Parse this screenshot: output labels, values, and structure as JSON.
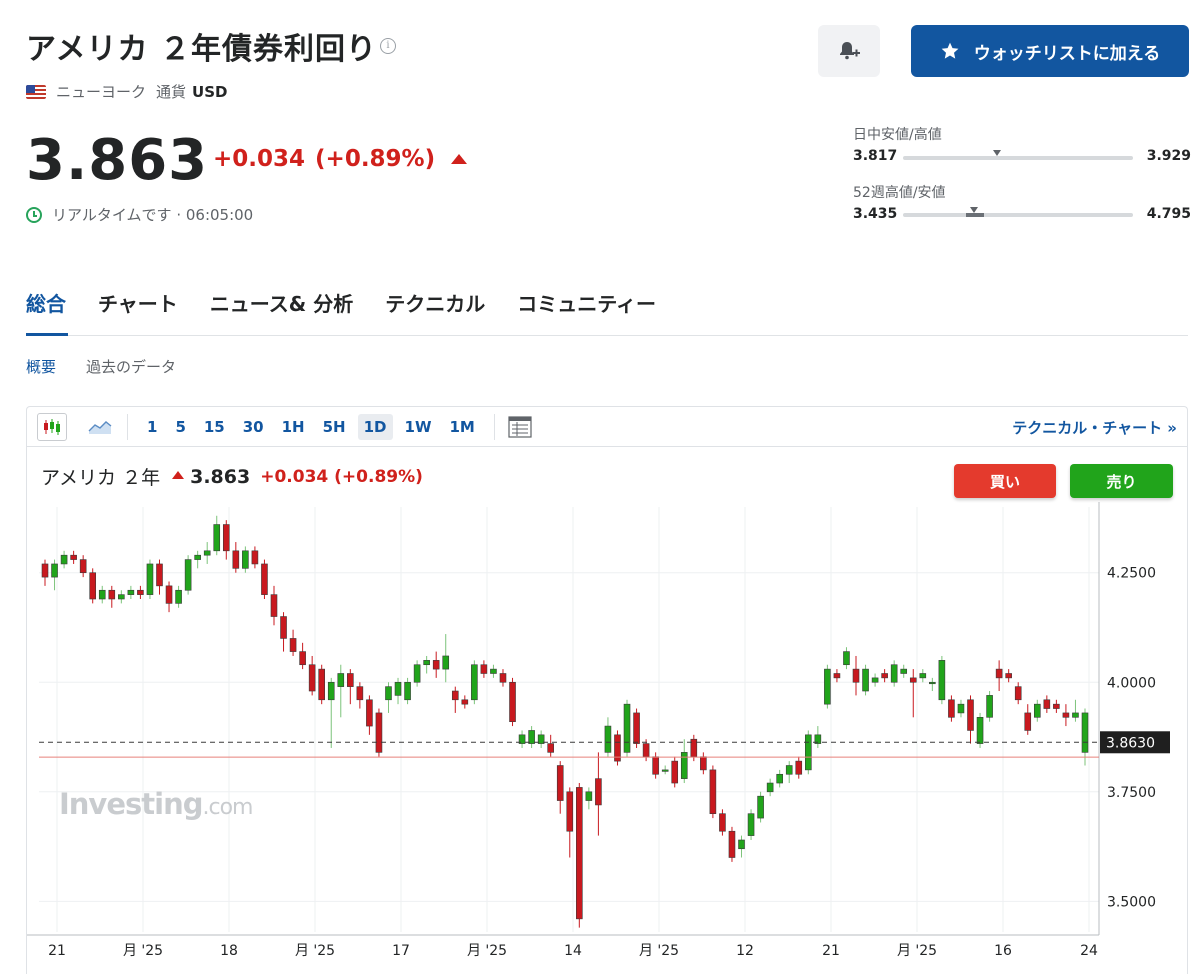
{
  "header": {
    "title": "アメリカ ２年債券利回り",
    "location": "ニューヨーク",
    "currency_label": "通貨",
    "currency": "USD",
    "watchlist_label": "ウォッチリストに加える",
    "info_glyph": "i"
  },
  "quote": {
    "price": "3.863",
    "change": "+0.034",
    "change_pct": "(+0.89%)",
    "realtime": "リアルタイムです · 06:05:00"
  },
  "ranges": {
    "day_label": "日中安値/高値",
    "day_low": "3.817",
    "day_high": "3.929",
    "day_position": 0.41,
    "week52_label": "52週高値/安値",
    "week52_low": "3.435",
    "week52_high": "4.795",
    "week52_position": 0.31
  },
  "tabs": [
    "総合",
    "チャート",
    "ニュース& 分析",
    "テクニカル",
    "コミュニティー"
  ],
  "subtabs": [
    "概要",
    "過去のデータ"
  ],
  "toolbar": {
    "intervals": [
      "1",
      "5",
      "15",
      "30",
      "1H",
      "5H",
      "1D",
      "1W",
      "1M"
    ],
    "active_interval": "1D",
    "tech_chart_label": "テクニカル・チャート »"
  },
  "legend": {
    "name": "アメリカ ２年",
    "price": "3.863",
    "change": "+0.034 (+0.89%)"
  },
  "buttons": {
    "buy": "買い",
    "sell": "売り"
  },
  "watermark": {
    "main": "Investing",
    "suffix": ".com"
  },
  "colors": {
    "up": "#21a41b",
    "down": "#c8191f",
    "accent": "#1256a0",
    "change": "#d0211c"
  },
  "chart_data": {
    "type": "candlestick",
    "y_ticks": [
      3.5,
      3.75,
      4.0,
      4.25
    ],
    "y_tick_labels": [
      "3.5000",
      "3.7500",
      "4.0000",
      "4.2500"
    ],
    "ylim": [
      3.43,
      4.4
    ],
    "x_tick_labels": [
      "21",
      "月 '25",
      "18",
      "月 '25",
      "17",
      "月 '25",
      "14",
      "月 '25",
      "12",
      "21",
      "月 '25",
      "16",
      "24"
    ],
    "current_price_label": "3.8630",
    "current_price": 3.863,
    "prev_close": 3.829,
    "candles": [
      [
        4.27,
        4.24,
        4.28,
        4.22
      ],
      [
        4.24,
        4.27,
        4.28,
        4.21
      ],
      [
        4.27,
        4.29,
        4.3,
        4.26
      ],
      [
        4.29,
        4.28,
        4.3,
        4.27
      ],
      [
        4.28,
        4.25,
        4.29,
        4.24
      ],
      [
        4.25,
        4.19,
        4.26,
        4.18
      ],
      [
        4.19,
        4.21,
        4.22,
        4.18
      ],
      [
        4.21,
        4.19,
        4.22,
        4.17
      ],
      [
        4.19,
        4.2,
        4.21,
        4.18
      ],
      [
        4.2,
        4.21,
        4.22,
        4.19
      ],
      [
        4.21,
        4.2,
        4.22,
        4.19
      ],
      [
        4.2,
        4.27,
        4.28,
        4.19
      ],
      [
        4.27,
        4.22,
        4.28,
        4.2
      ],
      [
        4.22,
        4.18,
        4.23,
        4.16
      ],
      [
        4.18,
        4.21,
        4.22,
        4.17
      ],
      [
        4.21,
        4.28,
        4.29,
        4.2
      ],
      [
        4.28,
        4.29,
        4.3,
        4.26
      ],
      [
        4.29,
        4.3,
        4.32,
        4.27
      ],
      [
        4.3,
        4.36,
        4.38,
        4.29
      ],
      [
        4.36,
        4.3,
        4.37,
        4.28
      ],
      [
        4.3,
        4.26,
        4.32,
        4.25
      ],
      [
        4.26,
        4.3,
        4.31,
        4.25
      ],
      [
        4.3,
        4.27,
        4.31,
        4.26
      ],
      [
        4.27,
        4.2,
        4.28,
        4.19
      ],
      [
        4.2,
        4.15,
        4.22,
        4.13
      ],
      [
        4.15,
        4.1,
        4.16,
        4.07
      ],
      [
        4.1,
        4.07,
        4.12,
        4.06
      ],
      [
        4.07,
        4.04,
        4.09,
        4.03
      ],
      [
        4.04,
        3.98,
        4.06,
        3.97
      ],
      [
        4.03,
        3.96,
        4.04,
        3.95
      ],
      [
        3.96,
        4.0,
        4.01,
        3.85
      ],
      [
        3.99,
        4.02,
        4.04,
        3.92
      ],
      [
        4.02,
        3.99,
        4.03,
        3.95
      ],
      [
        3.99,
        3.96,
        4.0,
        3.94
      ],
      [
        3.96,
        3.9,
        3.97,
        3.88
      ],
      [
        3.93,
        3.84,
        3.94,
        3.83
      ],
      [
        3.96,
        3.99,
        4.0,
        3.93
      ],
      [
        3.97,
        4.0,
        4.01,
        3.95
      ],
      [
        3.96,
        4.0,
        4.01,
        3.95
      ],
      [
        4.0,
        4.04,
        4.05,
        3.99
      ],
      [
        4.04,
        4.05,
        4.06,
        4.02
      ],
      [
        4.05,
        4.03,
        4.07,
        4.01
      ],
      [
        4.03,
        4.06,
        4.11,
        4.0
      ],
      [
        3.98,
        3.96,
        3.99,
        3.93
      ],
      [
        3.96,
        3.95,
        3.97,
        3.94
      ],
      [
        3.96,
        4.04,
        4.05,
        3.95
      ],
      [
        4.04,
        4.02,
        4.05,
        4.01
      ],
      [
        4.02,
        4.03,
        4.04,
        4.01
      ],
      [
        4.02,
        4.0,
        4.03,
        3.99
      ],
      [
        4.0,
        3.91,
        4.01,
        3.9
      ],
      [
        3.86,
        3.88,
        3.89,
        3.85
      ],
      [
        3.86,
        3.89,
        3.9,
        3.85
      ],
      [
        3.86,
        3.88,
        3.89,
        3.85
      ],
      [
        3.86,
        3.84,
        3.88,
        3.83
      ],
      [
        3.81,
        3.73,
        3.82,
        3.7
      ],
      [
        3.75,
        3.66,
        3.76,
        3.6
      ],
      [
        3.76,
        3.46,
        3.77,
        3.44
      ],
      [
        3.73,
        3.75,
        3.76,
        3.71
      ],
      [
        3.78,
        3.72,
        3.84,
        3.65
      ],
      [
        3.84,
        3.9,
        3.92,
        3.83
      ],
      [
        3.88,
        3.82,
        3.89,
        3.81
      ],
      [
        3.84,
        3.95,
        3.96,
        3.83
      ],
      [
        3.93,
        3.86,
        3.94,
        3.85
      ],
      [
        3.86,
        3.83,
        3.87,
        3.82
      ],
      [
        3.83,
        3.79,
        3.84,
        3.78
      ],
      [
        3.8,
        3.8,
        3.81,
        3.79
      ],
      [
        3.82,
        3.77,
        3.83,
        3.76
      ],
      [
        3.78,
        3.84,
        3.87,
        3.77
      ],
      [
        3.87,
        3.83,
        3.88,
        3.82
      ],
      [
        3.83,
        3.8,
        3.84,
        3.79
      ],
      [
        3.8,
        3.7,
        3.81,
        3.69
      ],
      [
        3.7,
        3.66,
        3.71,
        3.65
      ],
      [
        3.66,
        3.6,
        3.67,
        3.59
      ],
      [
        3.62,
        3.64,
        3.65,
        3.6
      ],
      [
        3.65,
        3.7,
        3.71,
        3.64
      ],
      [
        3.69,
        3.74,
        3.75,
        3.68
      ],
      [
        3.75,
        3.77,
        3.78,
        3.74
      ],
      [
        3.77,
        3.79,
        3.8,
        3.76
      ],
      [
        3.79,
        3.81,
        3.82,
        3.77
      ],
      [
        3.82,
        3.79,
        3.83,
        3.78
      ],
      [
        3.8,
        3.88,
        3.89,
        3.79
      ],
      [
        3.86,
        3.88,
        3.9,
        3.85
      ],
      [
        3.95,
        4.03,
        4.04,
        3.94
      ],
      [
        4.02,
        4.01,
        4.03,
        4.0
      ],
      [
        4.04,
        4.07,
        4.08,
        4.03
      ],
      [
        4.03,
        4.0,
        4.06,
        3.97
      ],
      [
        3.98,
        4.03,
        4.04,
        3.97
      ],
      [
        4.0,
        4.01,
        4.02,
        3.99
      ],
      [
        4.02,
        4.01,
        4.03,
        4.0
      ],
      [
        4.0,
        4.04,
        4.05,
        3.99
      ],
      [
        4.02,
        4.03,
        4.04,
        4.01
      ],
      [
        4.01,
        4.0,
        4.03,
        3.92
      ],
      [
        4.01,
        4.02,
        4.03,
        4.0
      ],
      [
        4.0,
        4.0,
        4.01,
        3.98
      ],
      [
        3.96,
        4.05,
        4.06,
        3.95
      ],
      [
        3.96,
        3.92,
        3.97,
        3.91
      ],
      [
        3.93,
        3.95,
        3.96,
        3.92
      ],
      [
        3.96,
        3.89,
        3.97,
        3.86
      ],
      [
        3.86,
        3.92,
        3.93,
        3.85
      ],
      [
        3.92,
        3.97,
        3.98,
        3.91
      ],
      [
        4.03,
        4.01,
        4.05,
        3.98
      ],
      [
        4.02,
        4.01,
        4.03,
        4.0
      ],
      [
        3.99,
        3.96,
        4.0,
        3.95
      ],
      [
        3.93,
        3.89,
        3.95,
        3.88
      ],
      [
        3.92,
        3.95,
        3.96,
        3.91
      ],
      [
        3.96,
        3.94,
        3.97,
        3.93
      ],
      [
        3.95,
        3.94,
        3.96,
        3.93
      ],
      [
        3.93,
        3.92,
        3.95,
        3.9
      ],
      [
        3.92,
        3.93,
        3.96,
        3.91
      ],
      [
        3.84,
        3.93,
        3.94,
        3.81
      ]
    ]
  }
}
